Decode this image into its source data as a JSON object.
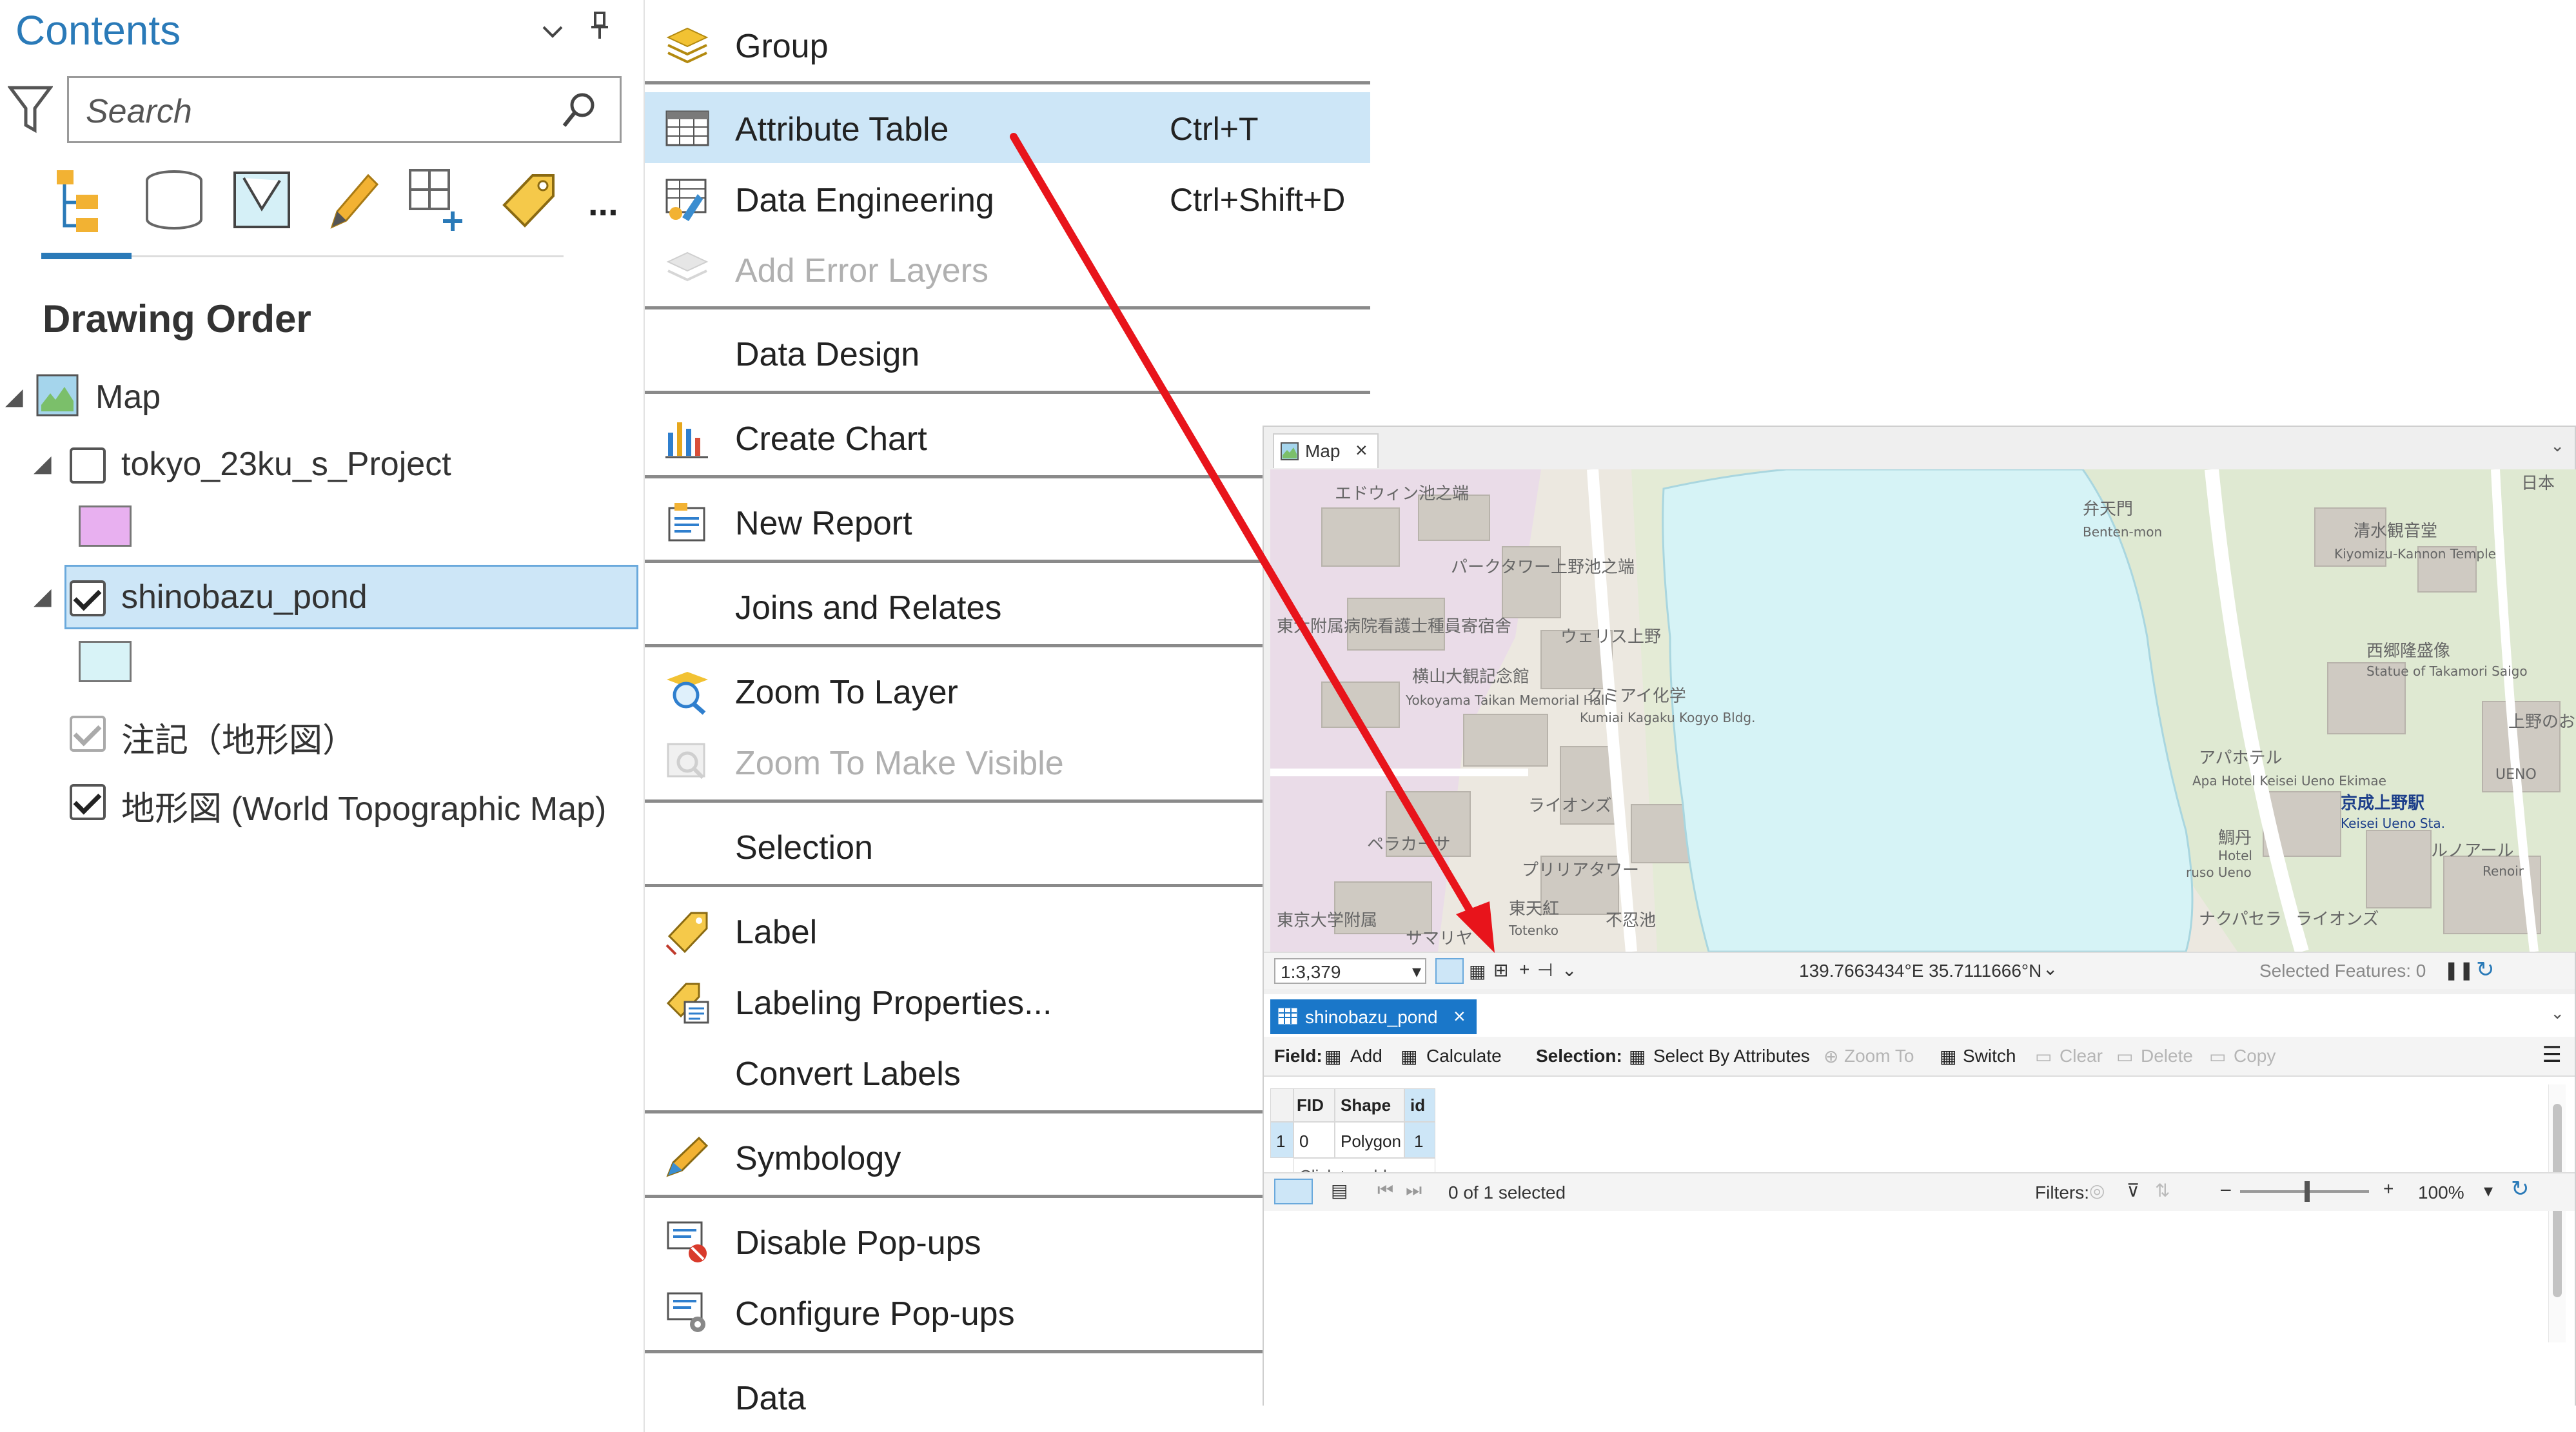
{
  "contents": {
    "title": "Contents",
    "search_placeholder": "Search",
    "section": "Drawing Order",
    "layers": [
      {
        "label": "Map",
        "checked": null
      },
      {
        "label": "tokyo_23ku_s_Project",
        "checked": false,
        "swatch": "#e8b0f0"
      },
      {
        "label": "shinobazu_pond",
        "checked": true,
        "swatch": "#d8f3f7"
      },
      {
        "label": "注記（地形図）",
        "checked": true
      },
      {
        "label": "地形図 (World Topographic Map)",
        "checked": true
      }
    ],
    "more": "..."
  },
  "menu": {
    "items": [
      {
        "label": "Group",
        "shortcut": ""
      },
      {
        "label": "Attribute Table",
        "shortcut": "Ctrl+T"
      },
      {
        "label": "Data Engineering",
        "shortcut": "Ctrl+Shift+D"
      },
      {
        "label": "Add Error Layers",
        "shortcut": "",
        "disabled": true
      },
      {
        "label": "Data Design",
        "shortcut": ""
      },
      {
        "label": "Create Chart",
        "shortcut": ""
      },
      {
        "label": "New Report",
        "shortcut": ""
      },
      {
        "label": "Joins and Relates",
        "shortcut": ""
      },
      {
        "label": "Zoom To Layer",
        "shortcut": ""
      },
      {
        "label": "Zoom To Make Visible",
        "shortcut": "",
        "disabled": true
      },
      {
        "label": "Selection",
        "shortcut": ""
      },
      {
        "label": "Label",
        "shortcut": ""
      },
      {
        "label": "Labeling Properties...",
        "shortcut": ""
      },
      {
        "label": "Convert Labels",
        "shortcut": ""
      },
      {
        "label": "Symbology",
        "shortcut": ""
      },
      {
        "label": "Disable Pop-ups",
        "shortcut": ""
      },
      {
        "label": "Configure Pop-ups",
        "shortcut": ""
      },
      {
        "label": "Data",
        "shortcut": ""
      }
    ]
  },
  "map": {
    "tab": "Map",
    "scale": "1:3,379",
    "coords": "139.7663434°E 35.7111666°N",
    "selected_features": "Selected Features: 0",
    "labels": [
      "エドウィン池之端",
      "パークタワー上野池之端",
      "東大附属病院看護士種員寄宿舎",
      "ウェリス上野",
      "横山大観記念館",
      "Yokoyama Taikan Memorial Hall",
      "クミアイ化学",
      "Kumiai Kagaku Kogyo Bldg.",
      "ライオンズ",
      "ペラカーサ",
      "プリリアタワー",
      "東天紅",
      "Totenko",
      "不忍池",
      "東京大学附属",
      "サマリヤ",
      "弁天門",
      "Benten-mon",
      "清水観音堂",
      "Kiyomizu-Kannon Temple",
      "西郷隆盛像",
      "Statue of Takamori Saigo",
      "アパホテル",
      "Apa Hotel Keisei Ueno Ekimae",
      "京成上野駅",
      "Keisei Ueno Sta.",
      "鯛丹",
      "Hotel",
      "ruso Ueno",
      "ナクパセラ",
      "ライオンズ",
      "ルノアール",
      "Renoir",
      "日本",
      "UENO",
      "上野のお"
    ]
  },
  "table": {
    "tab": "shinobazu_pond",
    "field_label": "Field:",
    "add": "Add",
    "calculate": "Calculate",
    "selection_label": "Selection:",
    "select_by_attributes": "Select By Attributes",
    "zoom_to": "Zoom To",
    "switch": "Switch",
    "clear": "Clear",
    "delete": "Delete",
    "copy": "Copy",
    "columns": [
      "FID",
      "Shape",
      "id"
    ],
    "rows": [
      [
        "0",
        "Polygon",
        "1"
      ]
    ],
    "row_number": "1",
    "add_new": "Click to add new",
    "selection_status": "0 of 1 selected",
    "filters": "Filters:",
    "zoom": "100%"
  },
  "colors": {
    "accent": "#2a7ab8",
    "highlight": "#cde6f7",
    "pond": "#d6f3f6",
    "arrow": "#e8141b"
  }
}
